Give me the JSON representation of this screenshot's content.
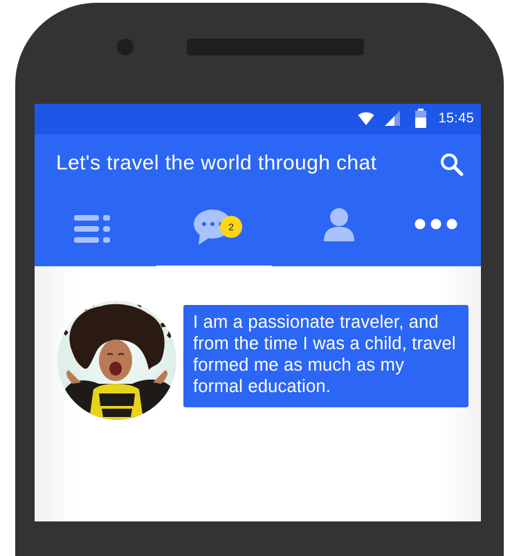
{
  "status_bar": {
    "time": "15:45",
    "icons": [
      "wifi-icon",
      "signal-icon",
      "battery-icon"
    ]
  },
  "app_bar": {
    "title": "Let's travel the world through chat",
    "search_icon": "search-icon"
  },
  "tabs": [
    {
      "icon": "list-icon",
      "selected": false
    },
    {
      "icon": "chat-bubble-icon",
      "selected": true,
      "badge": "2"
    },
    {
      "icon": "person-icon",
      "selected": false
    },
    {
      "icon": "more-icon",
      "selected": false
    }
  ],
  "message": {
    "text": "I am a passionate traveler, and\nfrom the time I was a child, travel\nformed me as much as my\nformal education."
  },
  "colors": {
    "status_bar": "#1e56e8",
    "app_bar": "#2b66f5",
    "tab_icon": "#a9c2fb",
    "badge": "#ffd519",
    "phone_body": "#333333"
  }
}
